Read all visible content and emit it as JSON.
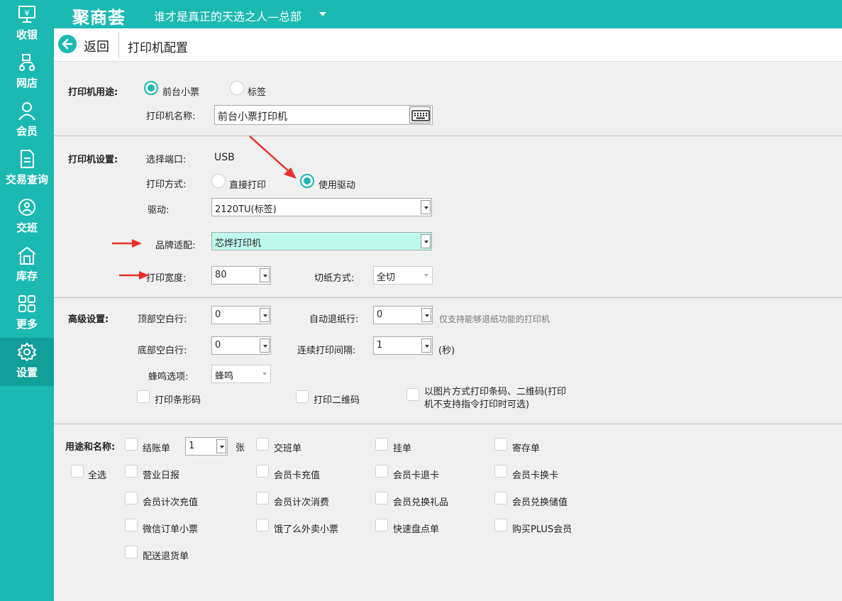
{
  "sidebar": {
    "items": [
      {
        "label": "收银",
        "icon": "cash-register-icon"
      },
      {
        "label": "网店",
        "icon": "delivery-scooter-icon"
      },
      {
        "label": "会员",
        "icon": "member-user-icon"
      },
      {
        "label": "交易查询",
        "icon": "document-icon"
      },
      {
        "label": "交班",
        "icon": "shift-handover-icon"
      },
      {
        "label": "库存",
        "icon": "warehouse-icon"
      },
      {
        "label": "更多",
        "icon": "grid-icon"
      },
      {
        "label": "设置",
        "icon": "gear-icon"
      }
    ],
    "active": "设置"
  },
  "header": {
    "logo": "聚商荟",
    "store": "谁才是真正的天选之人—总部"
  },
  "titlebar": {
    "back": "返回",
    "title": "打印机配置"
  },
  "purpose": {
    "section": "打印机用途:",
    "option_front": "前台小票",
    "option_label": "标签",
    "selected": "前台小票",
    "name_label": "打印机名称:",
    "name_value": "前台小票打印机"
  },
  "settings": {
    "section": "打印机设置:",
    "port_label": "选择端口:",
    "port_value": "USB",
    "mode_label": "打印方式:",
    "mode_direct": "直接打印",
    "mode_driver": "使用驱动",
    "mode_selected": "使用驱动",
    "driver_label": "驱动:",
    "driver_value": "2120TU(标签)",
    "brand_label": "品牌适配:",
    "brand_value": "芯烨打印机",
    "width_label": "打印宽度:",
    "width_value": "80",
    "cut_label": "切纸方式:",
    "cut_value": "全切"
  },
  "advanced": {
    "section": "高级设置:",
    "top_blank_label": "顶部空白行:",
    "top_blank_value": "0",
    "auto_retreat_label": "自动退纸行:",
    "auto_retreat_value": "0",
    "auto_retreat_hint": "仅支持能够退纸功能的打印机",
    "bottom_blank_label": "底部空白行:",
    "bottom_blank_value": "0",
    "interval_label": "连续打印间隔:",
    "interval_value": "1",
    "interval_unit": "(秒)",
    "buzzer_label": "蜂鸣选项:",
    "buzzer_value": "蜂鸣",
    "print_barcode": "打印条形码",
    "print_qrcode": "打印二维码",
    "image_mode_line1": "以图片方式打印条码、二维码(打印",
    "image_mode_line2": "机不支持指令打印时可选)"
  },
  "usage": {
    "section": "用途和名称:",
    "select_all": "全选",
    "copies_value": "1",
    "copies_unit": "张",
    "items": {
      "checkout": "结账单",
      "shift": "交班单",
      "hang": "挂单",
      "deposit": "寄存单",
      "daily": "营业日报",
      "card_recharge": "会员卡充值",
      "card_refund": "会员卡退卡",
      "card_exchange": "会员卡换卡",
      "count_recharge": "会员计次充值",
      "count_consume": "会员计次消费",
      "gift_exchange": "会员兑换礼品",
      "stored_exchange": "会员兑换储值",
      "wechat_order": "微信订单小票",
      "eleme_order": "饿了么外卖小票",
      "quick_count": "快速盘点单",
      "plus_member": "购买PLUS会员",
      "delivery_return": "配送退货单"
    }
  },
  "colors": {
    "accent": "#1bb9b2",
    "accent_dark": "#129f99",
    "highlight_field": "#bff8ed",
    "annotation_arrow": "#e8302a"
  }
}
